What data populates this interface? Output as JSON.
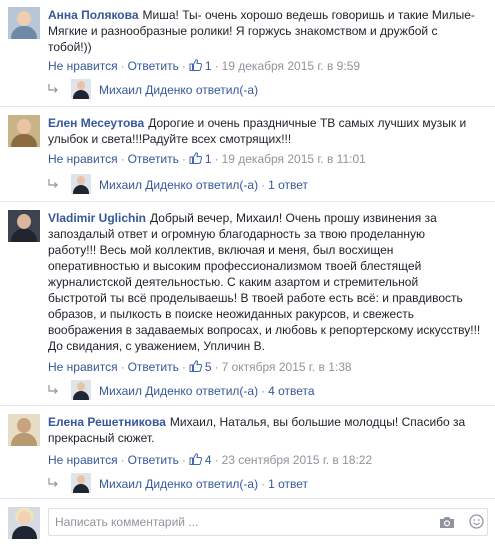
{
  "ui": {
    "dislike_label": "Не нравится",
    "reply_label": "Ответить",
    "dot": "·",
    "replied_suffix": "ответил(-а)",
    "composer_placeholder": "Написать комментарий ..."
  },
  "colors": {
    "link": "#365899",
    "meta": "#90949c",
    "text": "#1d2129",
    "divider": "#e5e6e9"
  },
  "comments": [
    {
      "author": "Анна Полякова",
      "text_lines": [
        "Миша! Ты- очень хорошо ведешь говоришь и такие Милые-",
        "Мягкие и разнообразные ролики! Я горжусь знакомством и дружбой с",
        "тобой!))"
      ],
      "likes": "1",
      "date": "19 декабря 2015 г. в 9:59",
      "reply_author": "Михаил Диденко",
      "reply_count": ""
    },
    {
      "author": "Елен Месеутова",
      "text_lines": [
        "Дорогие и очень праздничные ТВ самых лучших музык и",
        "улыбок и света!!!Радуйте всех смотрящих!!!"
      ],
      "likes": "1",
      "date": "19 декабря 2015 г. в 11:01",
      "reply_author": "Михаил Диденко",
      "reply_count": "1 ответ"
    },
    {
      "author": "Vladimir Uglichin",
      "text_lines": [
        "Добрый вечер, Михаил! Очень прошу извинения за",
        "запоздалый ответ и  огромную благодарность за твою проделанную",
        "работу!!! Весь мой коллектив, включая и меня, был восхищен",
        "оперативностью и высоким профессионализмом твоей блестящей",
        "журналистской деятельностью. С каким азартом и стремительной",
        "быстротой ты всё проделываешь! В твоей работе есть всё: и правдивость",
        "образов, и пылкость в поиске неожиданных ракурсов, и свежесть",
        "воображения в задаваемых вопросах, и любовь к репортерскому искусству!!!",
        "До свидания, с уважением, Упличин В."
      ],
      "likes": "5",
      "date": "7 октября 2015 г. в 1:38",
      "reply_author": "Михаил Диденко",
      "reply_count": "4 ответа"
    },
    {
      "author": "Елена Решетникова",
      "text_lines": [
        "Михаил, Наталья, вы большие молодцы! Спасибо за",
        "прекрасный сюжет."
      ],
      "likes": "4",
      "date": "23 сентября 2015 г. в 18:22",
      "reply_author": "Михаил Диденко",
      "reply_count": "1 ответ"
    }
  ]
}
